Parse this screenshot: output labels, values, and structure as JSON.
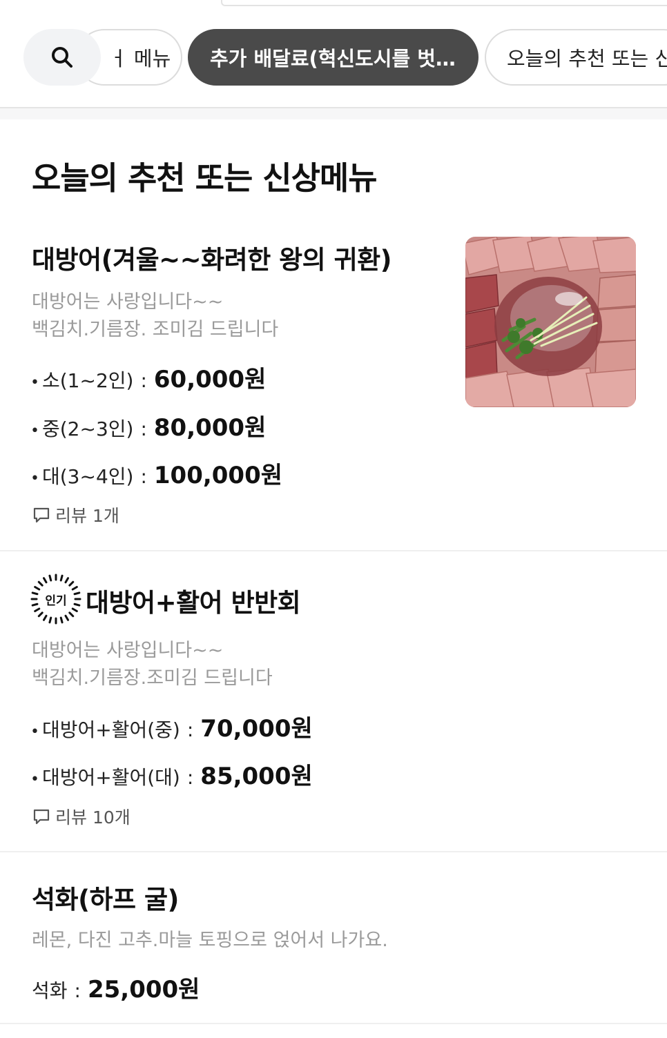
{
  "tabs": {
    "search_icon": "search-icon",
    "items": [
      {
        "label": "신상메뉴",
        "visible_label": "ㅓ 메뉴",
        "active": false
      },
      {
        "label": "추가 배달료(혁신도시를 벗어나면)",
        "visible_label": "추가 배달료(혁신도시를 벗…",
        "active": true
      },
      {
        "label": "오늘의 추천 또는 신상메뉴",
        "visible_label": "오늘의 추천 또는 신",
        "active": false
      }
    ]
  },
  "section": {
    "title": "오늘의 추천 또는 신상메뉴"
  },
  "menu": [
    {
      "title": "대방어(겨울~~화려한 왕의 귀환)",
      "desc_lines": [
        "대방어는 사랑입니다~~",
        "백김치.기름장. 조미김 드립니다"
      ],
      "prices": [
        {
          "bullet": "•",
          "option": "소(1~2인)",
          "colon": ":",
          "price": "60,000원"
        },
        {
          "bullet": "•",
          "option": "중(2~3인)",
          "colon": ":",
          "price": "80,000원"
        },
        {
          "bullet": "•",
          "option": "대(3~4인)",
          "colon": ":",
          "price": "100,000원"
        }
      ],
      "review": "리뷰 1개",
      "image_alt": "대방어 회 사진"
    },
    {
      "badge": "인기",
      "title": "대방어+활어  반반회",
      "desc_lines": [
        "대방어는 사랑입니다~~",
        "백김치.기름장.조미김 드립니다"
      ],
      "prices": [
        {
          "bullet": "•",
          "option": "대방어+활어(중)",
          "colon": ":",
          "price": "70,000원"
        },
        {
          "bullet": "•",
          "option": "대방어+활어(대)",
          "colon": ":",
          "price": "85,000원"
        }
      ],
      "review": "리뷰 10개"
    },
    {
      "title": "석화(하프 굴)",
      "desc_lines": [
        "레몬, 다진 고추.마늘 토핑으로 얹어서 나가요."
      ],
      "prices": [
        {
          "bullet": "",
          "option": "석화",
          "colon": ":",
          "price": "25,000원"
        }
      ]
    }
  ],
  "colors": {
    "active_chip": "#4a4a4a",
    "muted_text": "#9a9a9a",
    "divider": "#efefef"
  }
}
